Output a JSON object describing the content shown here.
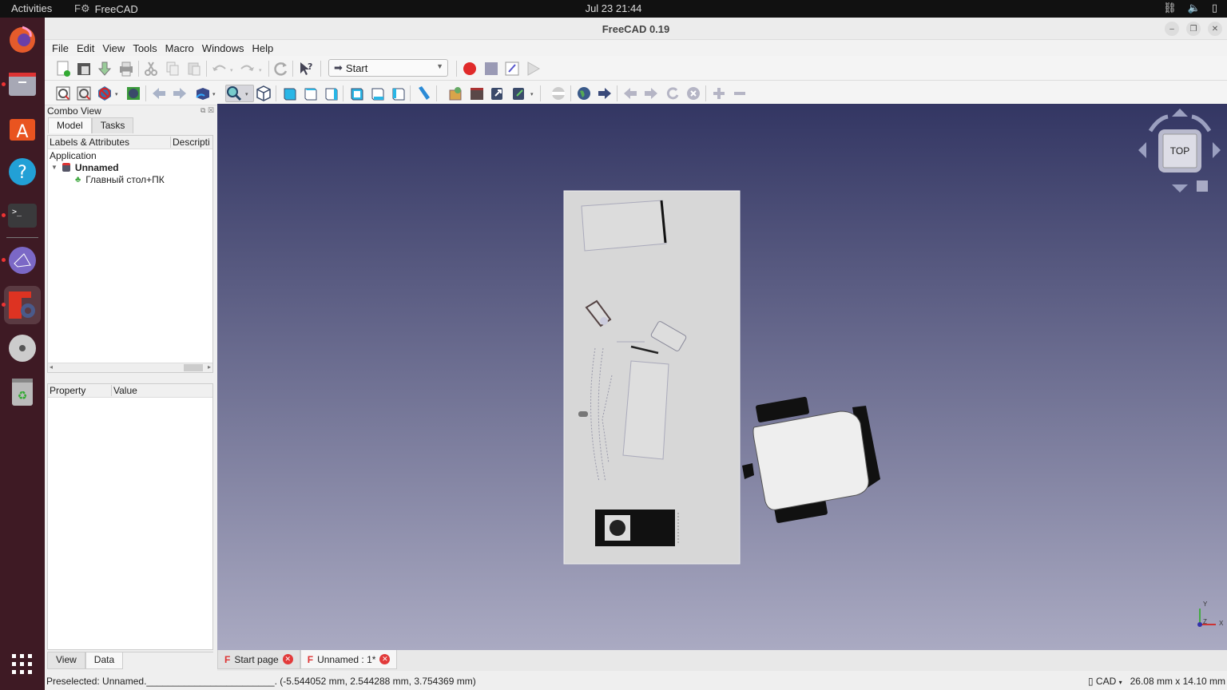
{
  "system": {
    "activities": "Activities",
    "app_name": "FreeCAD",
    "clock": "Jul 23  21:44",
    "tray_icons": [
      "network-icon",
      "volume-icon",
      "battery-icon"
    ]
  },
  "dock": {
    "items": [
      {
        "name": "firefox",
        "running": false
      },
      {
        "name": "files",
        "running": true
      },
      {
        "name": "app-center",
        "running": false
      },
      {
        "name": "help",
        "running": false
      },
      {
        "name": "terminal",
        "running": true
      },
      {
        "name": "network-app",
        "running": true
      },
      {
        "name": "freecad",
        "running": true,
        "active": true
      },
      {
        "name": "disc",
        "running": false
      },
      {
        "name": "trash",
        "running": false
      }
    ],
    "show_apps_icon": "grid-icon"
  },
  "window": {
    "title": "FreeCAD 0.19",
    "menu": [
      "File",
      "Edit",
      "View",
      "Tools",
      "Macro",
      "Windows",
      "Help"
    ],
    "workbench": "Start",
    "toolbar1_icons": [
      "new",
      "open",
      "save",
      "print",
      "cut",
      "copy",
      "paste",
      "undo",
      "redo",
      "refresh",
      "whats-this",
      "record-macro",
      "stop-macro",
      "edit-macro",
      "run-macro"
    ],
    "toolbar2_icons": [
      "fit-all",
      "fit-selection",
      "draw-style",
      "bounding-box",
      "back",
      "forward",
      "std-view",
      "zoom-box",
      "isometric",
      "front",
      "top",
      "right",
      "rear",
      "bottom",
      "left",
      "measure",
      "part",
      "group",
      "link",
      "link-actions",
      "section",
      "web-home",
      "web-go",
      "web-back",
      "web-forward",
      "web-refresh",
      "web-stop",
      "zoom-in",
      "zoom-out"
    ]
  },
  "combo": {
    "title": "Combo View",
    "tabs": [
      "Model",
      "Tasks"
    ],
    "tree_columns": [
      "Labels & Attributes",
      "Descripti"
    ],
    "tree": {
      "root": "Application",
      "document": "Unnamed",
      "object": "Главный стол+ПК"
    },
    "prop_columns": [
      "Property",
      "Value"
    ],
    "prop_tabs": [
      "View",
      "Data"
    ]
  },
  "viewport": {
    "navcube_face": "TOP",
    "axes": [
      "X",
      "Y",
      "Z"
    ],
    "bg_top": "#333663",
    "bg_bottom": "#aaaac2"
  },
  "doc_tabs": [
    {
      "label": "Start page",
      "active": false
    },
    {
      "label": "Unnamed : 1*",
      "active": true
    }
  ],
  "status": {
    "message": "Preselected: Unnamed.________________________. (-5.544052 mm, 2.544288 mm, 3.754369 mm)",
    "nav_style": "CAD",
    "dimensions": "26.08 mm x 14.10 mm"
  }
}
